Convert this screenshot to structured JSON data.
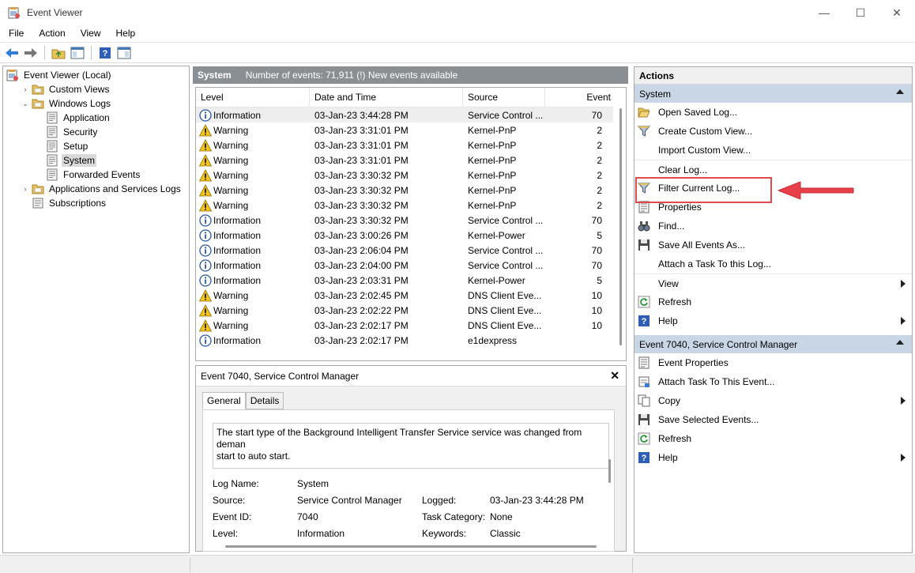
{
  "window": {
    "title": "Event Viewer",
    "minimize": "—",
    "maximize": "☐",
    "close": "✕"
  },
  "menu": [
    "File",
    "Action",
    "View",
    "Help"
  ],
  "tree": {
    "items": [
      {
        "label": "Event Viewer (Local)",
        "expander": "",
        "indent": 0,
        "icon": "event-viewer-icon"
      },
      {
        "label": "Custom Views",
        "expander": "›",
        "indent": 1,
        "icon": "folder-icon"
      },
      {
        "label": "Windows Logs",
        "expander": "⌄",
        "indent": 1,
        "icon": "folder-icon"
      },
      {
        "label": "Application",
        "expander": "",
        "indent": 2,
        "icon": "log-icon"
      },
      {
        "label": "Security",
        "expander": "",
        "indent": 2,
        "icon": "log-icon"
      },
      {
        "label": "Setup",
        "expander": "",
        "indent": 2,
        "icon": "log-icon"
      },
      {
        "label": "System",
        "expander": "",
        "indent": 2,
        "icon": "log-icon",
        "selected": true
      },
      {
        "label": "Forwarded Events",
        "expander": "",
        "indent": 2,
        "icon": "log-icon"
      },
      {
        "label": "Applications and Services Logs",
        "expander": "›",
        "indent": 1,
        "icon": "folder-icon"
      },
      {
        "label": "Subscriptions",
        "expander": "",
        "indent": 1,
        "icon": "subscriptions-icon"
      }
    ]
  },
  "center": {
    "title": "System",
    "subtitle": "Number of events: 71,911 (!) New events available"
  },
  "grid": {
    "columns": [
      "Level",
      "Date and Time",
      "Source",
      "Event"
    ],
    "rows": [
      [
        "Information",
        "03-Jan-23 3:44:28 PM",
        "Service Control ...",
        "70"
      ],
      [
        "Warning",
        "03-Jan-23 3:31:01 PM",
        "Kernel-PnP",
        "2"
      ],
      [
        "Warning",
        "03-Jan-23 3:31:01 PM",
        "Kernel-PnP",
        "2"
      ],
      [
        "Warning",
        "03-Jan-23 3:31:01 PM",
        "Kernel-PnP",
        "2"
      ],
      [
        "Warning",
        "03-Jan-23 3:30:32 PM",
        "Kernel-PnP",
        "2"
      ],
      [
        "Warning",
        "03-Jan-23 3:30:32 PM",
        "Kernel-PnP",
        "2"
      ],
      [
        "Warning",
        "03-Jan-23 3:30:32 PM",
        "Kernel-PnP",
        "2"
      ],
      [
        "Information",
        "03-Jan-23 3:30:32 PM",
        "Service Control ...",
        "70"
      ],
      [
        "Information",
        "03-Jan-23 3:00:26 PM",
        "Kernel-Power",
        "5"
      ],
      [
        "Information",
        "03-Jan-23 2:06:04 PM",
        "Service Control ...",
        "70"
      ],
      [
        "Information",
        "03-Jan-23 2:04:00 PM",
        "Service Control ...",
        "70"
      ],
      [
        "Information",
        "03-Jan-23 2:03:31 PM",
        "Kernel-Power",
        "5"
      ],
      [
        "Warning",
        "03-Jan-23 2:02:45 PM",
        "DNS Client Eve...",
        "10"
      ],
      [
        "Warning",
        "03-Jan-23 2:02:22 PM",
        "DNS Client Eve...",
        "10"
      ],
      [
        "Warning",
        "03-Jan-23 2:02:17 PM",
        "DNS Client Eve...",
        "10"
      ],
      [
        "Information",
        "03-Jan-23 2:02:17 PM",
        "e1dexpress",
        ""
      ]
    ]
  },
  "detail": {
    "title": "Event 7040, Service Control Manager",
    "close": "✕",
    "tabs": [
      "General",
      "Details"
    ],
    "description_line1": "The start type of the Background Intelligent Transfer Service service was changed from deman",
    "description_line2": "start to auto start.",
    "log_name_label": "Log Name:",
    "log_name": "System",
    "source_label": "Source:",
    "source": "Service Control Manager",
    "logged_label": "Logged:",
    "logged": "03-Jan-23 3:44:28 PM",
    "event_id_label": "Event ID:",
    "event_id": "7040",
    "task_category_label": "Task Category:",
    "task_category": "None",
    "level_label": "Level:",
    "level": "Information",
    "keywords_label": "Keywords:",
    "keywords": "Classic"
  },
  "actions": {
    "title": "Actions",
    "section1": "System",
    "section1_items": [
      {
        "label": "Open Saved Log...",
        "icon": "open-folder-icon"
      },
      {
        "label": "Create Custom View...",
        "icon": "filter-icon"
      },
      {
        "label": "Import Custom View...",
        "icon": ""
      },
      {
        "label": "Clear Log...",
        "icon": "",
        "sep": true
      },
      {
        "label": "Filter Current Log...",
        "icon": "filter-icon"
      },
      {
        "label": "Properties",
        "icon": "properties-icon"
      },
      {
        "label": "Find...",
        "icon": "binoculars-icon"
      },
      {
        "label": "Save All Events As...",
        "icon": "save-icon"
      },
      {
        "label": "Attach a Task To this Log...",
        "icon": ""
      },
      {
        "label": "View",
        "icon": "",
        "submenu": true,
        "sep": true
      },
      {
        "label": "Refresh",
        "icon": "refresh-icon"
      },
      {
        "label": "Help",
        "icon": "help-icon",
        "submenu": true
      }
    ],
    "section2": "Event 7040, Service Control Manager",
    "section2_items": [
      {
        "label": "Event Properties",
        "icon": "properties-icon"
      },
      {
        "label": "Attach Task To This Event...",
        "icon": "attach-task-icon"
      },
      {
        "label": "Copy",
        "icon": "copy-icon",
        "submenu": true
      },
      {
        "label": "Save Selected Events...",
        "icon": "save-icon"
      },
      {
        "label": "Refresh",
        "icon": "refresh-icon"
      },
      {
        "label": "Help",
        "icon": "help-icon",
        "submenu": true
      }
    ]
  },
  "colors": {
    "highlight": "#e04a4a",
    "arrow": "#e8404a",
    "header": "#8a8f94",
    "section": "#c9d6e5",
    "selected": "#d9d9d9"
  }
}
